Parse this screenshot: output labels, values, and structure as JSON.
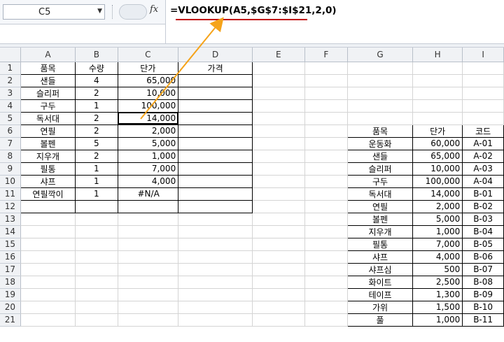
{
  "formula_bar": {
    "name_box": "C5",
    "fx_label": "fx",
    "formula": "=VLOOKUP(A5,$G$7:$I$21,2,0)"
  },
  "sheet": {
    "columns": [
      "A",
      "B",
      "C",
      "D",
      "E",
      "F",
      "G",
      "H",
      "I"
    ],
    "row_numbers": [
      "1",
      "2",
      "3",
      "4",
      "5",
      "6",
      "7",
      "8",
      "9",
      "10",
      "11",
      "12",
      "13",
      "14",
      "15",
      "16",
      "17",
      "18",
      "19",
      "20",
      "21"
    ],
    "left_table": {
      "headers": [
        "품목",
        "수량",
        "단가",
        "가격"
      ],
      "rows": [
        [
          "샌들",
          "4",
          "65,000",
          ""
        ],
        [
          "슬리퍼",
          "2",
          "10,000",
          ""
        ],
        [
          "구두",
          "1",
          "100,000",
          ""
        ],
        [
          "독서대",
          "2",
          "14,000",
          ""
        ],
        [
          "연필",
          "2",
          "2,000",
          ""
        ],
        [
          "볼펜",
          "5",
          "5,000",
          ""
        ],
        [
          "지우개",
          "2",
          "1,000",
          ""
        ],
        [
          "필통",
          "1",
          "7,000",
          ""
        ],
        [
          "샤프",
          "1",
          "4,000",
          ""
        ],
        [
          "연필깍이",
          "1",
          "#N/A",
          ""
        ],
        [
          "",
          "",
          "",
          ""
        ]
      ]
    },
    "right_table": {
      "headers": [
        "품목",
        "단가",
        "코드"
      ],
      "rows": [
        [
          "운동화",
          "60,000",
          "A-01"
        ],
        [
          "샌들",
          "65,000",
          "A-02"
        ],
        [
          "슬리퍼",
          "10,000",
          "A-03"
        ],
        [
          "구두",
          "100,000",
          "A-04"
        ],
        [
          "독서대",
          "14,000",
          "B-01"
        ],
        [
          "연필",
          "2,000",
          "B-02"
        ],
        [
          "볼펜",
          "5,000",
          "B-03"
        ],
        [
          "지우개",
          "1,000",
          "B-04"
        ],
        [
          "필통",
          "7,000",
          "B-05"
        ],
        [
          "샤프",
          "4,000",
          "B-06"
        ],
        [
          "샤프심",
          "500",
          "B-07"
        ],
        [
          "화이트",
          "2,500",
          "B-08"
        ],
        [
          "테이프",
          "1,300",
          "B-09"
        ],
        [
          "가위",
          "1,500",
          "B-10"
        ],
        [
          "풀",
          "1,000",
          "B-11"
        ]
      ]
    }
  },
  "colors": {
    "annotation_arrow": "#f5a31a",
    "formula_underline": "#c00000"
  }
}
